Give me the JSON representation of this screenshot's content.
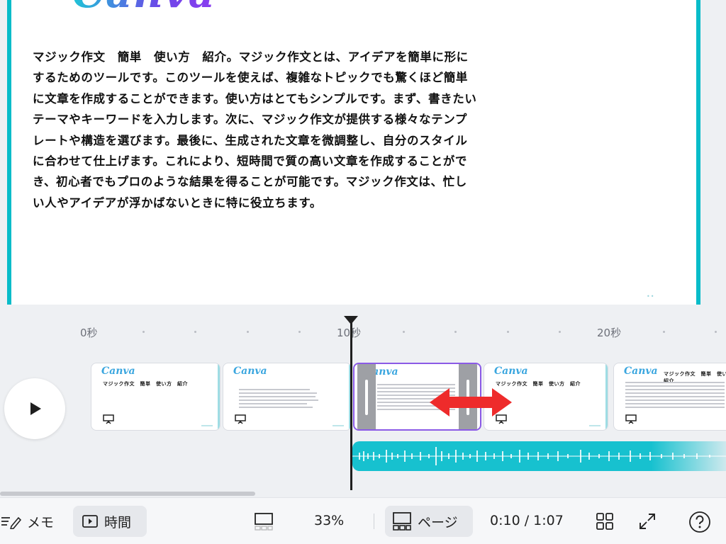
{
  "slide": {
    "logo": "Canva",
    "body": "マジック作文　簡単　使い方　紹介。マジック作文とは、アイデアを簡単に形にするためのツールです。このツールを使えば、複雑なトピックでも驚くほど簡単に文章を作成することができます。使い方はとてもシンプルです。まず、書きたいテーマやキーワードを入力します。次に、マジック作文が提供する様々なテンプレートや構造を選びます。最後に、生成された文章を微調整し、自分のスタイルに合わせて仕上げます。これにより、短時間で質の高い文章を作成することができ、初心者でもプロのような結果を得ることが可能です。マジック作文は、忙しい人やアイデアが浮かばないときに特に役立ちます。",
    "lines": [
      "マジック作文　簡単　使い方　紹介。マジック作文とは、アイデアを簡単に形に",
      "するためのツールです。このツールを使えば、複雑なトピックでも驚くほど簡単",
      "に文章を作成することができます。使い方はとてもシンプルです。まず、書きたい",
      "テーマやキーワードを入力します。次に、マジック作文が提供する様々なテンプ",
      "レートや構造を選びます。最後に、生成された文章を微調整し、自分のスタイル",
      "に合わせて仕上げます。これにより、短時間で質の高い文章を作成することがで",
      "き、初心者でもプロのような結果を得ることが可能です。マジック作文は、忙し",
      "い人やアイデアが浮かばないときに特に役立ちます。"
    ]
  },
  "timeline": {
    "ruler": [
      "0秒",
      "10秒",
      "20秒"
    ],
    "current_position_seconds": 10,
    "thumbnails": [
      {
        "logo": "Canva",
        "title": "マジック作文　簡単　使い方　紹介"
      },
      {
        "logo": "Canva",
        "title": ""
      },
      {
        "logo": "Canva",
        "title": "",
        "selected": true
      },
      {
        "logo": "Canva",
        "title": "マジック作文　簡単　使い方　紹介"
      },
      {
        "logo": "Canva",
        "title": "マジック作文　簡単　使い方　紹介"
      }
    ],
    "play_icon": "play-icon",
    "annotation": "resize-arrow"
  },
  "toolbar": {
    "notes_label": "メモ",
    "timer_label": "時間",
    "zoom": "33%",
    "pages_label": "ページ",
    "time_display": "0:10 / 1:07",
    "icons": [
      "notes-icon",
      "timer-icon",
      "layout-icon",
      "pages-icon",
      "grid-icon",
      "fullscreen-icon",
      "help-icon"
    ]
  },
  "colors": {
    "accent_teal": "#08bcc9",
    "selection_purple": "#8b5ae6",
    "arrow_red": "#ee2b2b"
  }
}
